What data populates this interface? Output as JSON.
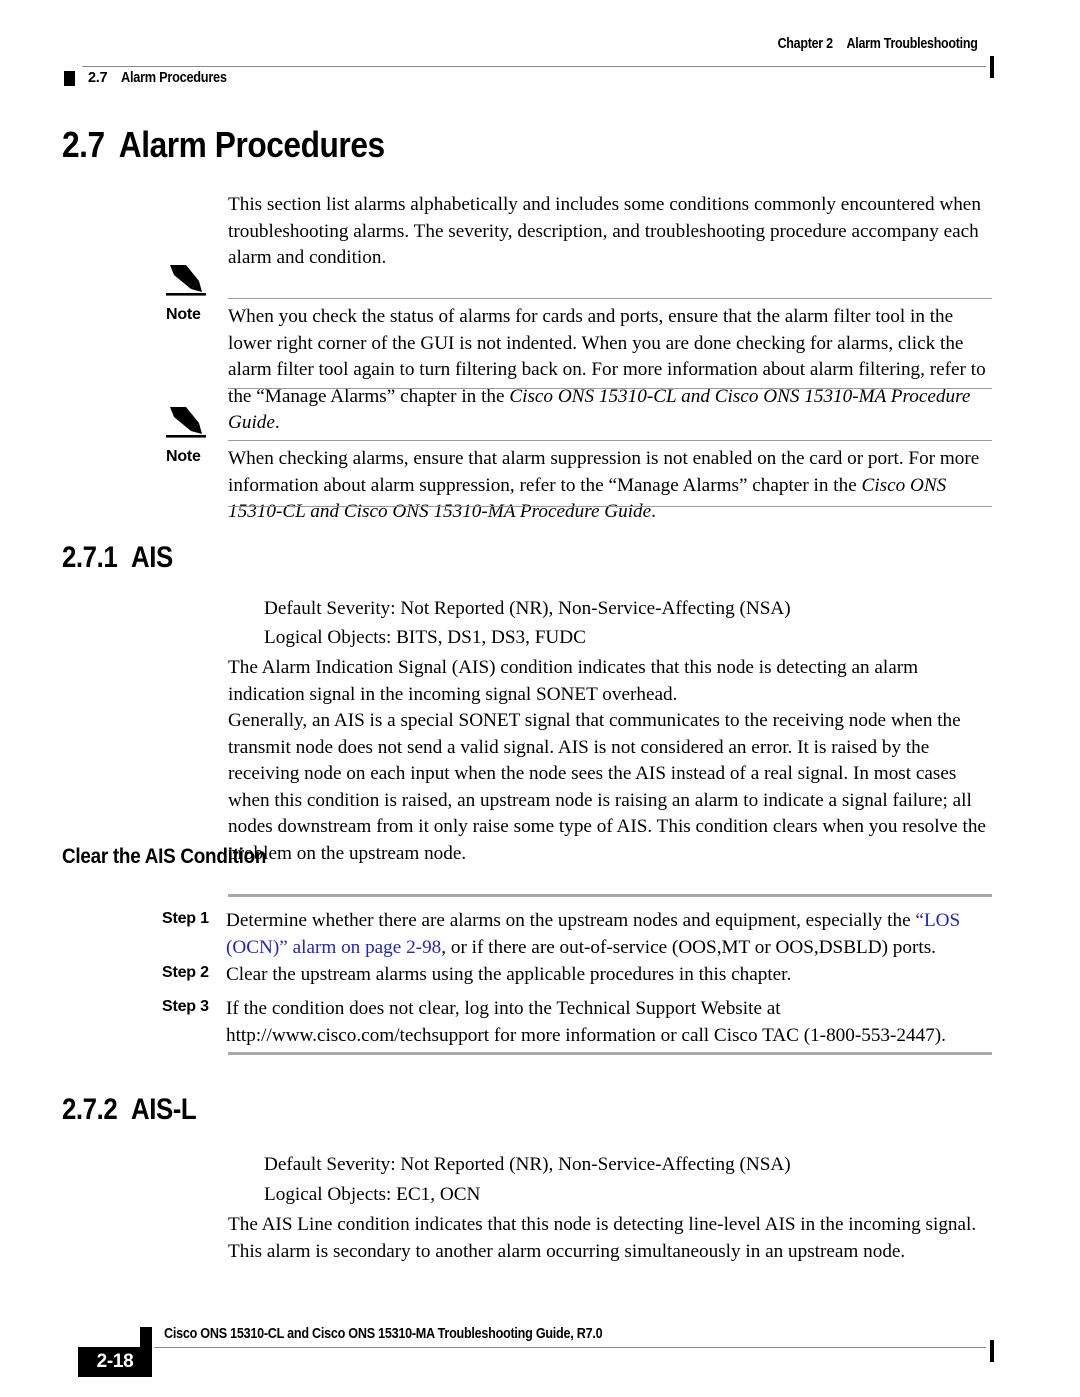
{
  "header": {
    "chapter": "Chapter 2",
    "chapter_title": "Alarm Troubleshooting",
    "section_number": "2.7",
    "section_label": "Alarm Procedures"
  },
  "section": {
    "number": "2.7",
    "title": "Alarm Procedures",
    "intro": "This section list alarms alphabetically and includes some conditions commonly encountered when troubleshooting alarms. The severity, description, and troubleshooting procedure accompany each alarm and condition."
  },
  "notes": [
    {
      "label": "Note",
      "icon": "pencil-note-icon",
      "text_plain": "When you check the status of alarms for cards and ports, ensure that the alarm filter tool in the lower right corner of the GUI is not indented. When you are done checking for alarms, click the alarm filter tool again to turn filtering back on. For more information about alarm filtering, refer to the “Manage Alarms” chapter in the Cisco ONS 15310-CL and Cisco ONS 15310-MA Procedure Guide.",
      "text_before": "When you check the status of alarms for cards and ports, ensure that the alarm filter tool in the lower right corner of the GUI is not indented. When you are done checking for alarms, click the alarm filter tool again to turn filtering back on. For more information about alarm filtering, refer to the “Manage Alarms” chapter in the ",
      "text_italic": "Cisco ONS 15310-CL and Cisco ONS 15310-MA Procedure Guide",
      "text_after": "."
    },
    {
      "label": "Note",
      "icon": "pencil-note-icon",
      "text_plain": "When checking alarms, ensure that alarm suppression is not enabled on the card or port. For more information about alarm suppression, refer to the “Manage Alarms” chapter in the Cisco ONS 15310-CL and Cisco ONS 15310-MA Procedure Guide.",
      "text_before": "When checking alarms, ensure that alarm suppression is not enabled on the card or port. For more information about alarm suppression, refer to the “Manage Alarms” chapter in the ",
      "text_italic": "Cisco ONS 15310-CL and Cisco ONS 15310-MA Procedure Guide",
      "text_after": "."
    }
  ],
  "ais": {
    "number": "2.7.1",
    "title": "AIS",
    "default_severity": "Default Severity: Not Reported (NR), Non-Service-Affecting (NSA)",
    "logical_objects": "Logical Objects: BITS, DS1, DS3, FUDC",
    "para1": "The Alarm Indication Signal (AIS) condition indicates that this node is detecting an alarm indication signal in the incoming signal SONET overhead.",
    "para2": "Generally, an AIS is a special SONET signal that communicates to the receiving node when the transmit node does not send a valid signal. AIS is not considered an error. It is raised by the receiving node on each input when the node sees the AIS instead of a real signal. In most cases when this condition is raised, an upstream node is raising an alarm to indicate a signal failure; all nodes downstream from it only raise some type of AIS. This condition clears when you resolve the problem on the upstream node.",
    "procedure_title": "Clear the AIS Condition",
    "steps": [
      {
        "label": "Step 1",
        "text_before": "Determine whether there are alarms on the upstream nodes and equipment, especially the ",
        "link": "“LOS (OCN)” alarm on page 2-98",
        "text_after": ", or if there are out-of-service (OOS,MT or OOS,DSBLD) ports."
      },
      {
        "label": "Step 2",
        "text_before": "Clear the upstream alarms using the applicable procedures in this chapter.",
        "link": "",
        "text_after": ""
      },
      {
        "label": "Step 3",
        "text_before": "If the condition does not clear, log into the Technical Support Website at http://www.cisco.com/techsupport for more information or call Cisco TAC (1-800-553-2447).",
        "link": "",
        "text_after": ""
      }
    ]
  },
  "aisl": {
    "number": "2.7.2",
    "title": "AIS-L",
    "default_severity": "Default Severity: Not Reported (NR), Non-Service-Affecting (NSA)",
    "logical_objects": "Logical Objects: EC1, OCN",
    "para1": "The AIS Line condition indicates that this node is detecting line-level AIS in the incoming signal. This alarm is secondary to another alarm occurring simultaneously in an upstream node."
  },
  "footer": {
    "page_number": "2-18",
    "guide_title": "Cisco ONS 15310-CL and Cisco ONS 15310-MA Troubleshooting Guide, R7.0"
  },
  "colors": {
    "link": "#2222cc",
    "rule": "#8a8a8a",
    "step_rule": "#a8a8a8",
    "text": "#000000"
  }
}
